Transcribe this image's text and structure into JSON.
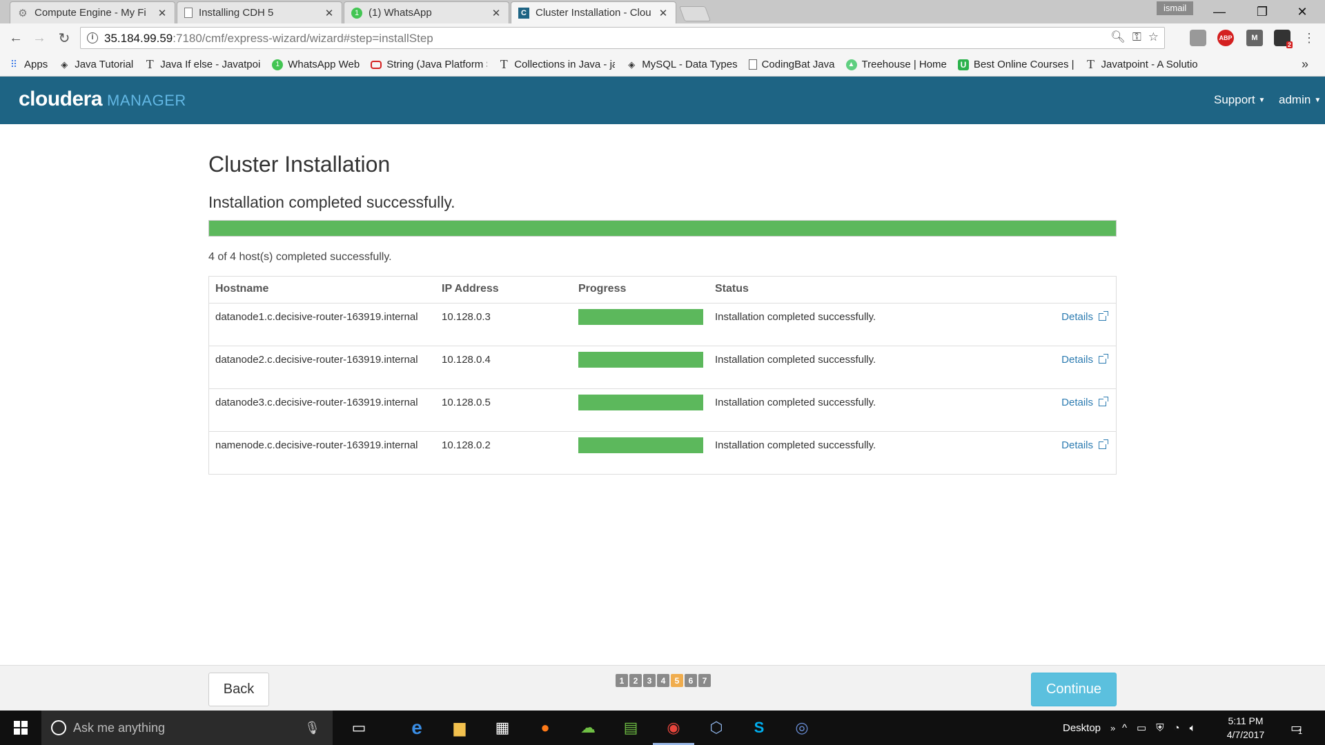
{
  "browser": {
    "tabs": [
      {
        "title": "Compute Engine - My Fi",
        "icon": "gear-icon",
        "active": false
      },
      {
        "title": "Installing CDH 5",
        "icon": "document-icon",
        "active": false
      },
      {
        "title": "(1) WhatsApp",
        "icon": "whatsapp-icon",
        "active": false
      },
      {
        "title": "Cluster Installation - Clou",
        "icon": "cloudera-icon",
        "active": true
      }
    ],
    "user_badge": "ismail",
    "url": {
      "host": "35.184.99.59",
      "path": ":7180/cmf/express-wizard/wizard#step=installStep"
    },
    "extension_abp_label": "ABP",
    "extension_badge_count": "2",
    "bookmarks": [
      {
        "label": "Apps",
        "icon": "apps-grid-icon"
      },
      {
        "label": "Java Tutorial",
        "icon": "diamond-icon"
      },
      {
        "label": "Java If else - Javatpoir",
        "icon": "t-icon"
      },
      {
        "label": "WhatsApp Web",
        "icon": "whatsapp-icon"
      },
      {
        "label": "String (Java Platform S",
        "icon": "oracle-icon"
      },
      {
        "label": "Collections in Java - ja",
        "icon": "t-icon"
      },
      {
        "label": "MySQL - Data Types",
        "icon": "diamond-icon"
      },
      {
        "label": "CodingBat Java",
        "icon": "document-icon"
      },
      {
        "label": "Treehouse | Home",
        "icon": "treehouse-icon"
      },
      {
        "label": "Best Online Courses |",
        "icon": "udemy-icon"
      },
      {
        "label": "Javatpoint - A Solutio",
        "icon": "t-icon"
      }
    ],
    "bookmarks_more": "»"
  },
  "header": {
    "brand": "cloudera",
    "product": "MANAGER",
    "menu_support": "Support",
    "menu_admin": "admin"
  },
  "page": {
    "title": "Cluster Installation",
    "subtitle": "Installation completed successfully.",
    "overall_progress": 1.0,
    "hosts_summary": "4 of 4 host(s) completed successfully."
  },
  "table": {
    "columns": [
      "Hostname",
      "IP Address",
      "Progress",
      "Status"
    ],
    "rows": [
      {
        "hostname": "datanode1.c.decisive-router-163919.internal",
        "ip": "10.128.0.3",
        "progress": 1.0,
        "status": "Installation completed successfully.",
        "details": "Details"
      },
      {
        "hostname": "datanode2.c.decisive-router-163919.internal",
        "ip": "10.128.0.4",
        "progress": 1.0,
        "status": "Installation completed successfully.",
        "details": "Details"
      },
      {
        "hostname": "datanode3.c.decisive-router-163919.internal",
        "ip": "10.128.0.5",
        "progress": 1.0,
        "status": "Installation completed successfully.",
        "details": "Details"
      },
      {
        "hostname": "namenode.c.decisive-router-163919.internal",
        "ip": "10.128.0.2",
        "progress": 1.0,
        "status": "Installation completed successfully.",
        "details": "Details"
      }
    ]
  },
  "footer": {
    "back_label": "Back",
    "continue_label": "Continue",
    "steps": [
      "1",
      "2",
      "3",
      "4",
      "5",
      "6",
      "7"
    ],
    "current_step": "5"
  },
  "taskbar": {
    "search_placeholder": "Ask me anything",
    "desktop_label": "Desktop",
    "time": "5:11 PM",
    "date": "4/7/2017",
    "notification_count": "1"
  },
  "colors": {
    "header_bg": "#1e6484",
    "progress_green": "#5cb85c",
    "continue_blue": "#5bc0de",
    "current_step": "#f0ad4e"
  }
}
